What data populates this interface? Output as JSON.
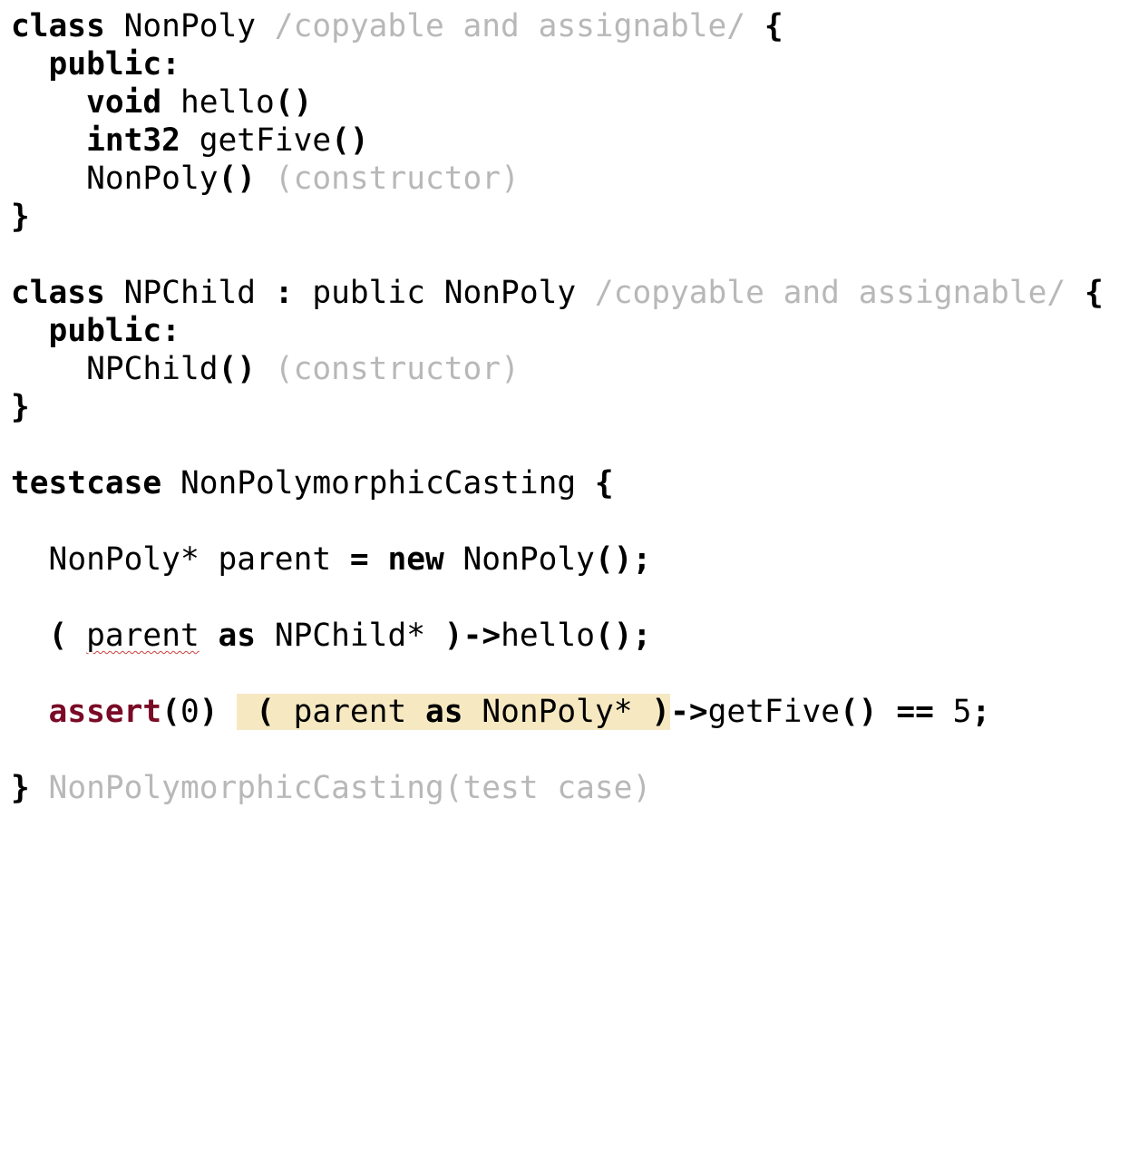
{
  "code": {
    "line1": {
      "kw": "class",
      "name": " NonPoly ",
      "comment": "/copyable and assignable/",
      "brace": " {"
    },
    "line2": {
      "indent": "  ",
      "kw": "public",
      "colon": ":"
    },
    "line3": {
      "indent": "    ",
      "kw": "void",
      "name": " hello",
      "parens": "()"
    },
    "line4": {
      "indent": "    ",
      "kw": "int32",
      "name": " getFive",
      "parens": "()"
    },
    "line5": {
      "indent": "    ",
      "name": "NonPoly",
      "parens": "()",
      "comment": " (constructor)"
    },
    "line6": {
      "brace": "}"
    },
    "line8": {
      "kw": "class",
      "name": " NPChild ",
      "colon": ":",
      "rest": " public NonPoly ",
      "comment": "/copyable and assignable/",
      "brace": " {"
    },
    "line9": {
      "indent": "  ",
      "kw": "public",
      "colon": ":"
    },
    "line10": {
      "indent": "    ",
      "name": "NPChild",
      "parens": "()",
      "comment": " (constructor)"
    },
    "line11": {
      "brace": "}"
    },
    "line13": {
      "kw": "testcase",
      "name": " NonPolymorphicCasting ",
      "brace": "{"
    },
    "line15": {
      "indent": "  ",
      "type": "NonPoly* parent ",
      "eq": "=",
      "sp": " ",
      "kw": "new",
      "name": " NonPoly",
      "parens": "()",
      "semi": ";"
    },
    "line17": {
      "indent": "  ",
      "open": "(",
      "sp": " ",
      "var": "parent",
      "sp2": " ",
      "kw": "as",
      "type": " NPChild* ",
      "close": ")",
      "arrow": "->",
      "name": "hello",
      "parens": "()",
      "semi": ";"
    },
    "line19": {
      "indent": "  ",
      "kw": "assert",
      "arg_open": "(",
      "arg": "0",
      "arg_close": ")",
      "sp": " ",
      "open": " (",
      "var": " parent ",
      "kw2": "as",
      "type": " NonPoly* ",
      "close": ")",
      "arrow": "->",
      "name": "getFive",
      "parens": "()",
      "op": " == ",
      "eqop": "==",
      "num": " 5",
      "semi": ";"
    },
    "line21": {
      "brace": "}",
      "comment": " NonPolymorphicCasting(test case)"
    }
  }
}
